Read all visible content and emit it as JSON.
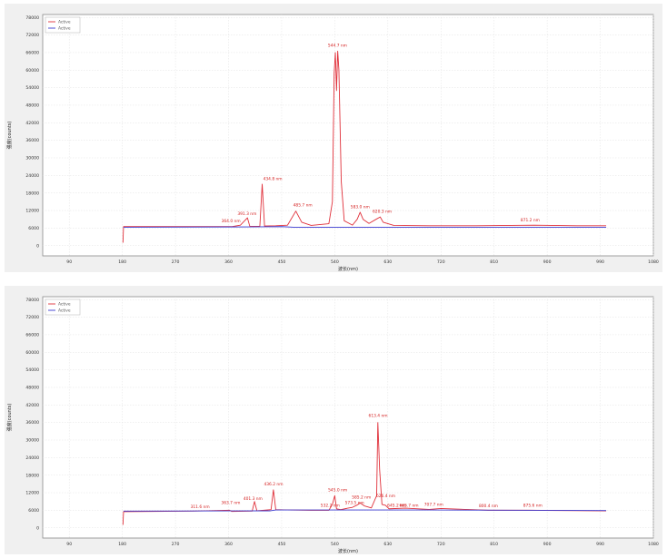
{
  "chart_data": [
    {
      "type": "line",
      "xlabel": "波长(nm)",
      "ylabel": "强度(counts)",
      "xlim": [
        180,
        1000
      ],
      "ylim": [
        -3500,
        72000
      ],
      "x_ticks": [
        "90",
        "180",
        "270",
        "360",
        "450",
        "540",
        "630",
        "720",
        "810",
        "900",
        "990",
        "1080"
      ],
      "y_ticks": [
        "0",
        "6000",
        "12000",
        "18000",
        "24000",
        "30000",
        "36000",
        "42000",
        "48000",
        "54000",
        "60000",
        "66000",
        "72000",
        "78000"
      ],
      "legend": {
        "position": "top-left",
        "entries": [
          "Active",
          "Active"
        ]
      },
      "colors": {
        "series1": "#e0303a",
        "series2": "#3a3ad0"
      },
      "series": [
        {
          "name": "Active",
          "color": "#e0303a",
          "points": [
            [
              181,
              1000
            ],
            [
              182,
              6500
            ],
            [
              365,
              6500
            ],
            [
              380,
              7000
            ],
            [
              392,
              9500
            ],
            [
              396,
              6600
            ],
            [
              413,
              6600
            ],
            [
              417,
              21000
            ],
            [
              421,
              6700
            ],
            [
              440,
              6800
            ],
            [
              460,
              7000
            ],
            [
              474,
              11800
            ],
            [
              484,
              8000
            ],
            [
              500,
              6900
            ],
            [
              530,
              7500
            ],
            [
              536,
              15000
            ],
            [
              539,
              59000
            ],
            [
              541,
              66000
            ],
            [
              543,
              53000
            ],
            [
              545,
              66500
            ],
            [
              547,
              60000
            ],
            [
              551,
              22000
            ],
            [
              556,
              8500
            ],
            [
              570,
              7000
            ],
            [
              578,
              9000
            ],
            [
              583,
              11400
            ],
            [
              588,
              9000
            ],
            [
              598,
              7600
            ],
            [
              610,
              9000
            ],
            [
              617,
              9800
            ],
            [
              622,
              8000
            ],
            [
              640,
              6900
            ],
            [
              700,
              6800
            ],
            [
              780,
              6800
            ],
            [
              878,
              7000
            ],
            [
              950,
              6800
            ],
            [
              1000,
              6800
            ]
          ]
        },
        {
          "name": "Active",
          "color": "#3a3ad0",
          "points": [
            [
              182,
              6300
            ],
            [
              400,
              6400
            ],
            [
              450,
              6500
            ],
            [
              470,
              6300
            ],
            [
              700,
              6300
            ],
            [
              1000,
              6300
            ]
          ]
        }
      ],
      "annotations": [
        {
          "x": 364.0,
          "y": 7500,
          "text": "364.0 nm"
        },
        {
          "x": 391.3,
          "y": 10000,
          "text": "391.3 nm"
        },
        {
          "x": 434.8,
          "y": 22000,
          "text": "434.8 nm"
        },
        {
          "x": 485.7,
          "y": 13000,
          "text": "485.7 nm"
        },
        {
          "x": 544.7,
          "y": 67500,
          "text": "544.7 nm"
        },
        {
          "x": 583.0,
          "y": 12300,
          "text": "583.0 nm"
        },
        {
          "x": 620.3,
          "y": 10700,
          "text": "620.3 nm"
        },
        {
          "x": 871.2,
          "y": 7800,
          "text": "871.2 nm"
        }
      ]
    },
    {
      "type": "line",
      "xlabel": "波长(nm)",
      "ylabel": "强度(counts)",
      "xlim": [
        180,
        1000
      ],
      "ylim": [
        -3500,
        72000
      ],
      "x_ticks": [
        "90",
        "180",
        "270",
        "360",
        "450",
        "540",
        "630",
        "720",
        "810",
        "900",
        "990",
        "1080"
      ],
      "y_ticks": [
        "0",
        "6000",
        "12000",
        "18000",
        "24000",
        "30000",
        "36000",
        "42000",
        "48000",
        "54000",
        "60000",
        "66000",
        "72000",
        "78000"
      ],
      "legend": {
        "position": "top-left",
        "entries": [
          "Active",
          "Active"
        ]
      },
      "colors": {
        "series1": "#e0303a",
        "series2": "#3a3ad0"
      },
      "series": [
        {
          "name": "Active",
          "color": "#e0303a",
          "points": [
            [
              181,
              1000
            ],
            [
              182,
              5500
            ],
            [
              300,
              5700
            ],
            [
              362,
              6000
            ],
            [
              365,
              5600
            ],
            [
              400,
              5700
            ],
            [
              404,
              9000
            ],
            [
              408,
              5800
            ],
            [
              432,
              6200
            ],
            [
              436,
              13000
            ],
            [
              440,
              6200
            ],
            [
              460,
              6100
            ],
            [
              500,
              6000
            ],
            [
              530,
              6000
            ],
            [
              536,
              8000
            ],
            [
              540,
              11000
            ],
            [
              543,
              6500
            ],
            [
              550,
              6200
            ],
            [
              562,
              6700
            ],
            [
              570,
              7000
            ],
            [
              578,
              7800
            ],
            [
              583,
              8500
            ],
            [
              590,
              7500
            ],
            [
              602,
              6800
            ],
            [
              611,
              11000
            ],
            [
              613,
              36000
            ],
            [
              616,
              20000
            ],
            [
              620,
              8000
            ],
            [
              626,
              7700
            ],
            [
              632,
              6500
            ],
            [
              660,
              6700
            ],
            [
              700,
              6300
            ],
            [
              720,
              6600
            ],
            [
              800,
              6000
            ],
            [
              870,
              6000
            ],
            [
              1000,
              5800
            ]
          ]
        },
        {
          "name": "Active",
          "color": "#3a3ad0",
          "points": [
            [
              182,
              5700
            ],
            [
              430,
              5800
            ],
            [
              440,
              6100
            ],
            [
              700,
              6100
            ],
            [
              1000,
              5900
            ]
          ]
        }
      ],
      "annotations": [
        {
          "x": 311.6,
          "y": 6300,
          "text": "311.6 nm"
        },
        {
          "x": 363.7,
          "y": 7600,
          "text": "363.7 nm"
        },
        {
          "x": 401.3,
          "y": 9000,
          "text": "401.3 nm"
        },
        {
          "x": 436.2,
          "y": 14000,
          "text": "436.2 nm"
        },
        {
          "x": 532.2,
          "y": 6800,
          "text": "532.2 nm"
        },
        {
          "x": 545.0,
          "y": 12000,
          "text": "545.0 nm"
        },
        {
          "x": 573.5,
          "y": 7600,
          "text": "573.5 nm"
        },
        {
          "x": 585.2,
          "y": 9500,
          "text": "585.2 nm"
        },
        {
          "x": 613.4,
          "y": 37500,
          "text": "613.4 nm"
        },
        {
          "x": 626.4,
          "y": 10000,
          "text": "626.4 nm"
        },
        {
          "x": 645.2,
          "y": 6800,
          "text": "645.2 nm"
        },
        {
          "x": 665.7,
          "y": 6800,
          "text": "665.7 nm"
        },
        {
          "x": 707.7,
          "y": 7000,
          "text": "707.7 nm"
        },
        {
          "x": 800.4,
          "y": 6600,
          "text": "800.4 nm"
        },
        {
          "x": 875.6,
          "y": 6800,
          "text": "875.6 nm"
        }
      ]
    }
  ]
}
